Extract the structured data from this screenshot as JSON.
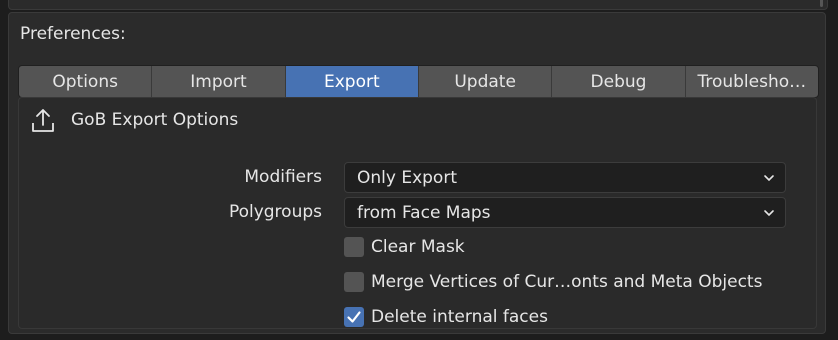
{
  "panel": {
    "title": "Preferences:"
  },
  "tabs": [
    {
      "label": "Options",
      "active": false
    },
    {
      "label": "Import",
      "active": false
    },
    {
      "label": "Export",
      "active": true
    },
    {
      "label": "Update",
      "active": false
    },
    {
      "label": "Debug",
      "active": false
    },
    {
      "label": "Troublesho…",
      "active": false
    }
  ],
  "section": {
    "title": "GoB Export Options",
    "icon": "export-icon"
  },
  "fields": {
    "modifiers": {
      "label": "Modifiers",
      "value": "Only Export"
    },
    "polygroups": {
      "label": "Polygroups",
      "value": "from Face Maps"
    }
  },
  "checkboxes": [
    {
      "label": "Clear Mask",
      "checked": false
    },
    {
      "label": "Merge Vertices of Cur…onts and Meta Objects",
      "checked": false
    },
    {
      "label": "Delete internal faces",
      "checked": true
    }
  ],
  "colors": {
    "accent": "#4772b3",
    "tab_bg": "#545454",
    "panel_bg": "#2b2b2b",
    "field_bg": "#1f1f1f"
  }
}
